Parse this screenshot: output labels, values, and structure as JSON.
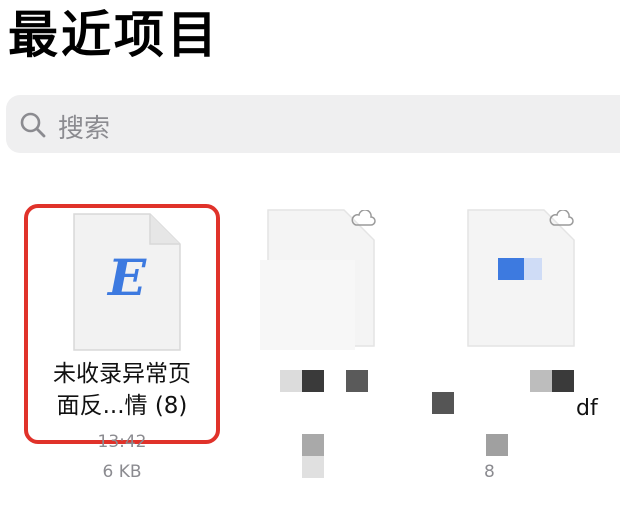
{
  "header": {
    "title": "最近项目"
  },
  "search": {
    "placeholder": "搜索"
  },
  "files": [
    {
      "icon_glyph": "E",
      "name_line1": "未收录异常页",
      "name_line2": "面反...情 (8)",
      "time": "13:42",
      "size": "6 KB",
      "selected": true
    },
    {
      "name_fragment": ""
    },
    {
      "name_fragment": "df",
      "meta_fragment": "8"
    }
  ],
  "colors": {
    "selection_border": "#e0322a",
    "doc_glyph": "#3d7ae0",
    "search_bg": "#efeff0",
    "secondary_text": "#8b8b90"
  }
}
